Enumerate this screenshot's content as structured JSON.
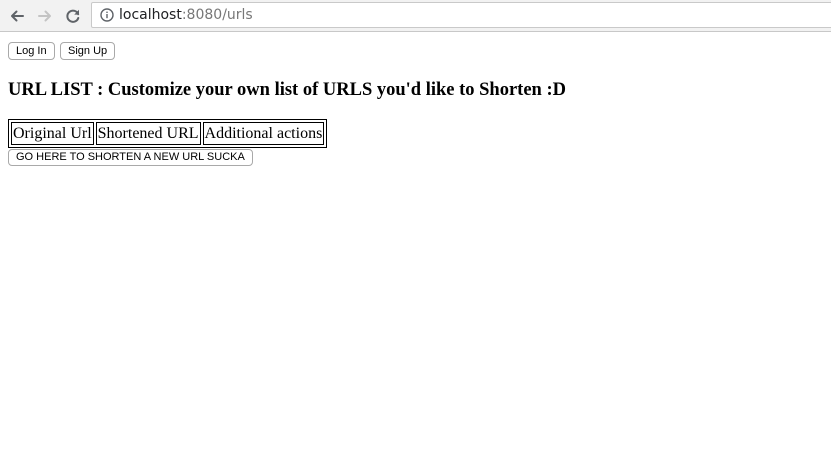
{
  "browser": {
    "url_host": "localhost",
    "url_rest": ":8080/urls",
    "icons": {
      "back": "arrow-left-icon",
      "forward": "arrow-right-icon",
      "reload": "reload-icon",
      "site_info": "info-circle-icon"
    }
  },
  "page": {
    "login_label": "Log In",
    "signup_label": "Sign Up",
    "heading": "URL LIST : Customize your own list of URLS you'd like to Shorten :D",
    "table": {
      "headers": [
        "Original Url",
        "Shortened URL",
        "Additional actions"
      ],
      "rows": []
    },
    "shorten_button_label": "GO HERE TO SHORTEN A NEW URL SUCKA"
  }
}
